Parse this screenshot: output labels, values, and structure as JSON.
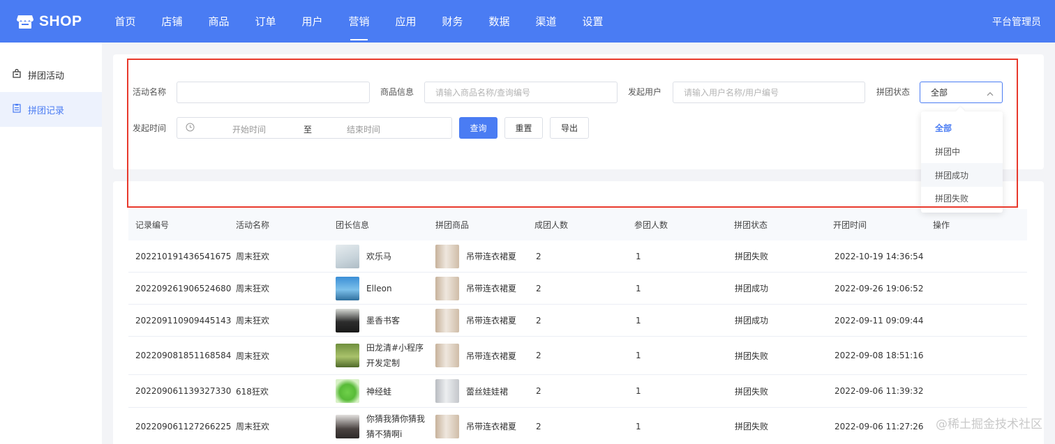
{
  "header": {
    "logo_text": "SHOP",
    "nav": [
      "首页",
      "店铺",
      "商品",
      "订单",
      "用户",
      "营销",
      "应用",
      "财务",
      "数据",
      "渠道",
      "设置"
    ],
    "active_nav": "营销",
    "admin": "平台管理员"
  },
  "sidebar": {
    "items": [
      {
        "label": "拼团活动",
        "icon": "bag-icon",
        "active": false
      },
      {
        "label": "拼团记录",
        "icon": "clipboard-icon",
        "active": true
      }
    ]
  },
  "filters": {
    "activity_name": {
      "label": "活动名称",
      "value": "",
      "placeholder": ""
    },
    "product_info": {
      "label": "商品信息",
      "value": "",
      "placeholder": "请输入商品名称/查询编号"
    },
    "initiator": {
      "label": "发起用户",
      "value": "",
      "placeholder": "请输入用户名称/用户编号"
    },
    "status": {
      "label": "拼团状态",
      "value": "全部"
    },
    "time": {
      "label": "发起时间",
      "start_placeholder": "开始时间",
      "separator": "至",
      "end_placeholder": "结束时间"
    },
    "buttons": {
      "query": "查询",
      "reset": "重置",
      "export": "导出"
    }
  },
  "status_dropdown": {
    "options": [
      "全部",
      "拼团中",
      "拼团成功",
      "拼团失败"
    ],
    "selected": "全部",
    "hovered": "拼团成功"
  },
  "table": {
    "columns": [
      "记录编号",
      "活动名称",
      "团长信息",
      "拼团商品",
      "成团人数",
      "参团人数",
      "拼团状态",
      "开团时间",
      "操作"
    ],
    "rows": [
      {
        "id": "202210191436541675",
        "activity": "周末狂欢",
        "leader": "欢乐马",
        "product": "吊带连衣裙夏",
        "group_size": "2",
        "joined": "1",
        "status": "拼团失败",
        "time": "2022-10-19 14:36:54"
      },
      {
        "id": "202209261906524680",
        "activity": "周末狂欢",
        "leader": "Elleon",
        "product": "吊带连衣裙夏",
        "group_size": "2",
        "joined": "1",
        "status": "拼团成功",
        "time": "2022-09-26 19:06:52"
      },
      {
        "id": "202209110909445143",
        "activity": "周末狂欢",
        "leader": "墨香书客",
        "product": "吊带连衣裙夏",
        "group_size": "2",
        "joined": "1",
        "status": "拼团成功",
        "time": "2022-09-11 09:09:44"
      },
      {
        "id": "202209081851168584",
        "activity": "周末狂欢",
        "leader": "田龙清#小程序开发定制",
        "product": "吊带连衣裙夏",
        "group_size": "2",
        "joined": "1",
        "status": "拼团失败",
        "time": "2022-09-08 18:51:16"
      },
      {
        "id": "202209061139327330",
        "activity": "618狂欢",
        "leader": "神经蛙",
        "product": "蕾丝娃娃裙",
        "group_size": "2",
        "joined": "1",
        "status": "拼团失败",
        "time": "2022-09-06 11:39:32"
      },
      {
        "id": "202209061127266225",
        "activity": "周末狂欢",
        "leader": "你猜我猜你猜我猜不猜啊i",
        "product": "吊带连衣裙夏",
        "group_size": "2",
        "joined": "1",
        "status": "拼团失败",
        "time": "2022-09-06 11:27:26"
      }
    ]
  },
  "watermark": "@稀土掘金技术社区",
  "colors": {
    "primary": "#4a7cf3",
    "highlight_border": "#e8392c"
  }
}
